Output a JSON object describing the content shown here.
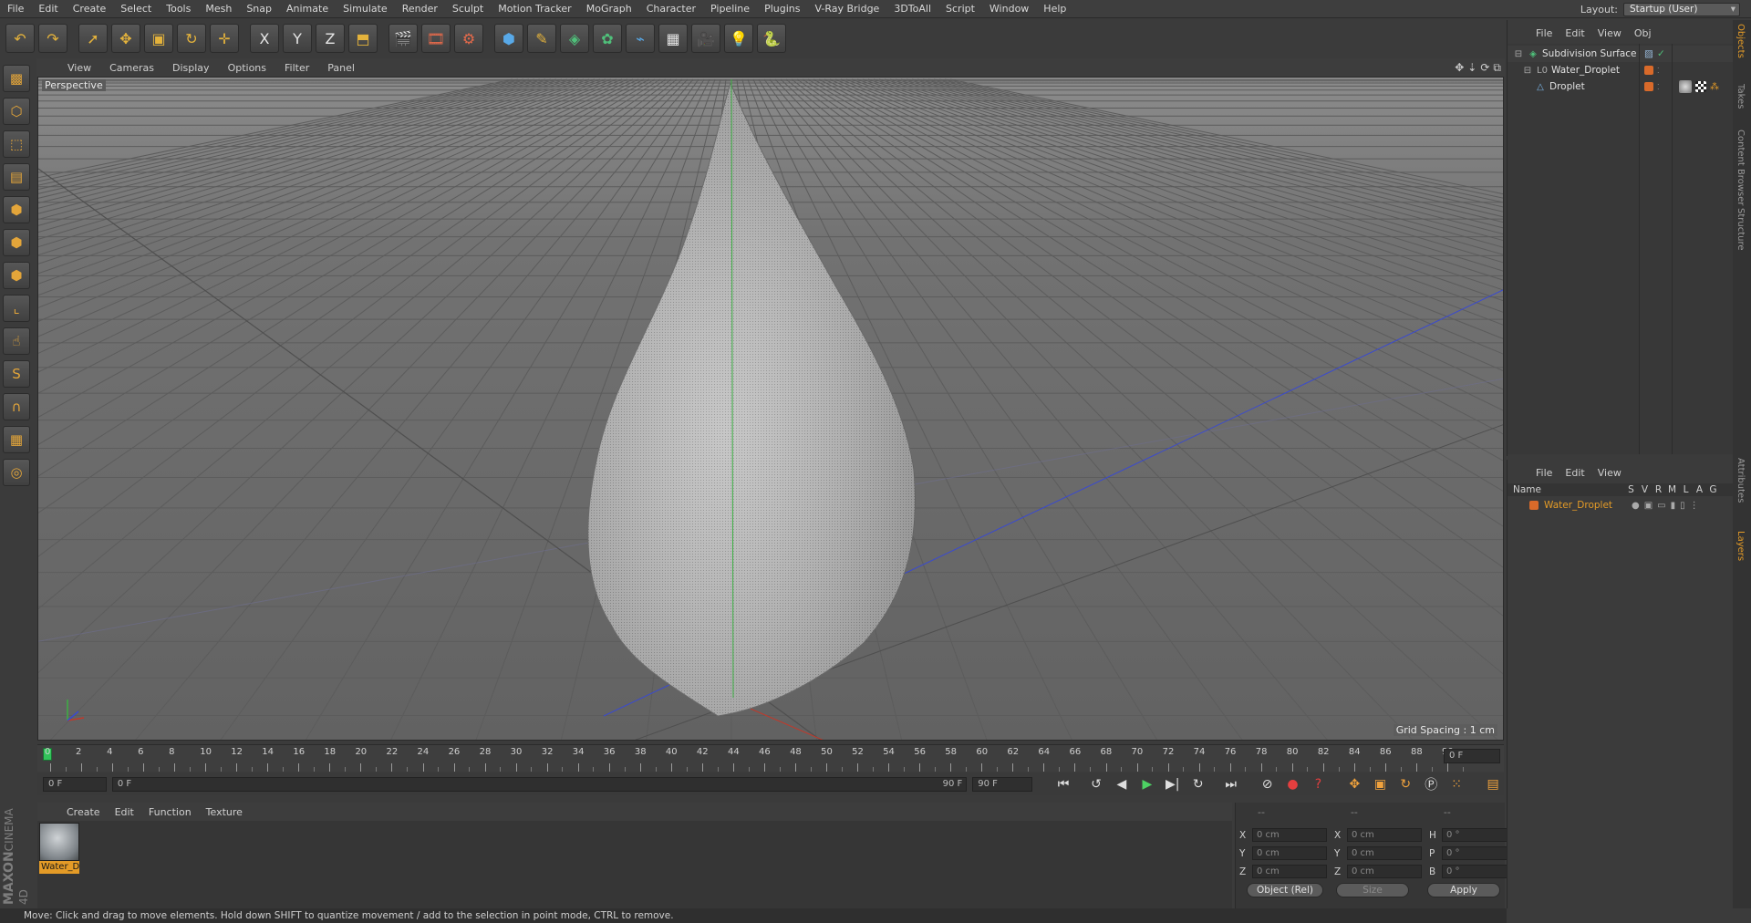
{
  "menubar": {
    "items": [
      "File",
      "Edit",
      "Create",
      "Select",
      "Tools",
      "Mesh",
      "Snap",
      "Animate",
      "Simulate",
      "Render",
      "Sculpt",
      "Motion Tracker",
      "MoGraph",
      "Character",
      "Pipeline",
      "Plugins",
      "V-Ray Bridge",
      "3DToAll",
      "Script",
      "Window",
      "Help"
    ],
    "layout_label": "Layout:",
    "layout_value": "Startup (User)"
  },
  "toolbar": {
    "icons": [
      "undo-icon",
      "redo-icon",
      "select-arrow-icon",
      "move-icon",
      "scale-icon",
      "rotate-icon",
      "live-selection-icon",
      "x-axis-icon",
      "y-axis-icon",
      "z-axis-icon",
      "world-coord-icon",
      "render-view-icon",
      "render-picture-viewer-icon",
      "render-settings-icon",
      "cube-primitive-icon",
      "pen-spline-icon",
      "subdivision-icon",
      "cloner-icon",
      "deformer-icon",
      "floor-icon",
      "camera-icon",
      "light-icon",
      "python-icon"
    ],
    "glyphs": [
      "↶",
      "↷",
      "➚",
      "✥",
      "▣",
      "↻",
      "✛",
      "X",
      "Y",
      "Z",
      "⬒",
      "🎬",
      "🎞",
      "⚙",
      "⬢",
      "✎",
      "◈",
      "✿",
      "⌁",
      "▦",
      "🎥",
      "💡",
      "🐍"
    ]
  },
  "lefttools": {
    "icons": [
      "make-editable-icon",
      "model-mode-icon",
      "texture-mode-icon",
      "workplane-icon",
      "points-mode-icon",
      "edges-mode-icon",
      "polygons-mode-icon",
      "axis-icon",
      "tweak-icon",
      "solo-icon",
      "magnet-icon",
      "grid-snap-icon",
      "lock-workplane-icon"
    ],
    "glyphs": [
      "▩",
      "⬡",
      "⬚",
      "▤",
      "⬢",
      "⬢",
      "⬢",
      "⌞",
      "☝",
      "S",
      "∩",
      "▦",
      "◎"
    ]
  },
  "viewport": {
    "menu": [
      "View",
      "Cameras",
      "Display",
      "Options",
      "Filter",
      "Panel"
    ],
    "label": "Perspective",
    "grid_spacing": "Grid Spacing : 1 cm"
  },
  "timeline": {
    "ticks": [
      "0",
      "2",
      "4",
      "6",
      "8",
      "10",
      "12",
      "14",
      "16",
      "18",
      "20",
      "22",
      "24",
      "26",
      "28",
      "30",
      "32",
      "34",
      "36",
      "38",
      "40",
      "42",
      "44",
      "46",
      "48",
      "50",
      "52",
      "54",
      "56",
      "58",
      "60",
      "62",
      "64",
      "66",
      "68",
      "70",
      "72",
      "74",
      "76",
      "78",
      "80",
      "82",
      "84",
      "86",
      "88",
      "90"
    ],
    "current_frame": "0 F"
  },
  "playbar": {
    "start": "0 F",
    "range_start": "0 F",
    "range_end": "90 F",
    "end": "90 F"
  },
  "material": {
    "menu": [
      "Create",
      "Edit",
      "Function",
      "Texture"
    ],
    "name": "Water_Droplet",
    "logo_top": "MAXON",
    "logo_bottom": "CINEMA 4D"
  },
  "coords": {
    "headers": [
      "--",
      "--",
      "--"
    ],
    "rows": [
      {
        "a": "X",
        "av": "0 cm",
        "b": "X",
        "bv": "0 cm",
        "c": "H",
        "cv": "0 °"
      },
      {
        "a": "Y",
        "av": "0 cm",
        "b": "Y",
        "bv": "0 cm",
        "c": "P",
        "cv": "0 °"
      },
      {
        "a": "Z",
        "av": "0 cm",
        "b": "Z",
        "bv": "0 cm",
        "c": "B",
        "cv": "0 °"
      }
    ],
    "mode": "Object (Rel)",
    "size": "Size",
    "apply": "Apply"
  },
  "objects": {
    "menu": [
      "File",
      "Edit",
      "View",
      "Obj"
    ],
    "items": [
      {
        "name": "Subdivision Surface"
      },
      {
        "name": "Water_Droplet"
      },
      {
        "name": "Droplet"
      }
    ]
  },
  "layers": {
    "menu": [
      "File",
      "Edit",
      "View"
    ],
    "columns": [
      "Name",
      "S",
      "V",
      "R",
      "M",
      "L",
      "A",
      "G"
    ],
    "row_name": "Water_Droplet"
  },
  "sidetabs": [
    "Objects",
    "Takes",
    "Content Browser",
    "Structure",
    "Attributes",
    "Layers"
  ],
  "status": "Move: Click and drag to move elements. Hold down SHIFT to quantize movement / add to the selection in point mode, CTRL to remove.",
  "colors": {
    "accent": "#e49b27",
    "axis_x": "#c0392b",
    "axis_y": "#3cb043",
    "axis_z": "#3b4fd6"
  }
}
